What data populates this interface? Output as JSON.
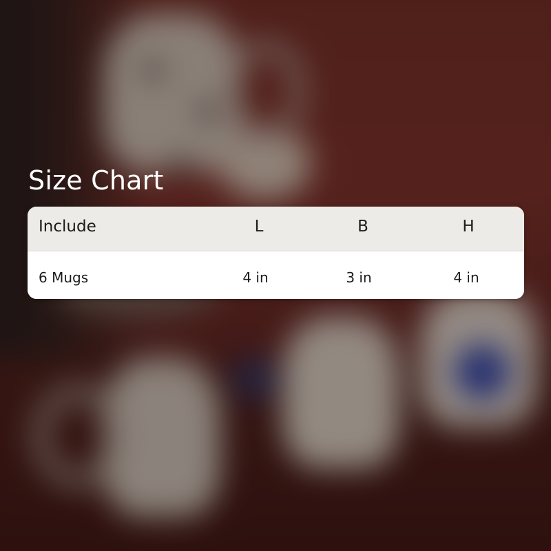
{
  "title": "Size Chart",
  "table": {
    "headers": [
      "Include",
      "L",
      "B",
      "H"
    ],
    "rows": [
      [
        "6 Mugs",
        "4 in",
        "3 in",
        "4 in"
      ]
    ]
  },
  "background": {
    "description_color_accent": "#7a3029"
  }
}
